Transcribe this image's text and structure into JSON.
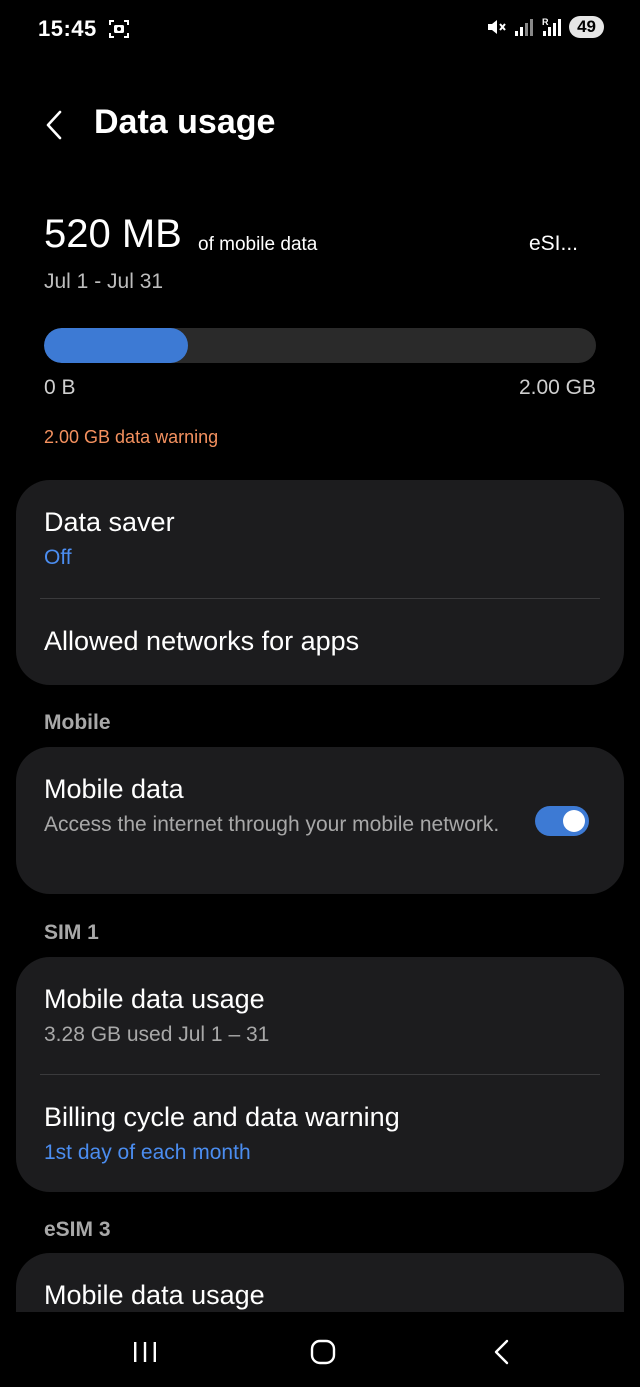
{
  "status_bar": {
    "time": "15:45",
    "battery": "49",
    "icons": [
      "screenshot-icon",
      "mute-vibrate-icon",
      "signal-icon",
      "roaming-signal-icon"
    ]
  },
  "header": {
    "back_icon": "chevron-left-icon",
    "title": "Data usage"
  },
  "usage": {
    "amount": "520 MB",
    "unit_label": "of mobile data",
    "sim": "eSI...",
    "period": "Jul 1 - Jul 31",
    "bar_min": "0 B",
    "bar_max": "2.00 GB",
    "fill_fraction": 0.26,
    "warning": "2.00 GB data warning"
  },
  "settings": {
    "data_saver_title": "Data saver",
    "data_saver_value": "Off",
    "allowed_networks": "Allowed networks for apps"
  },
  "mobile_section": {
    "label": "Mobile",
    "mobile_data_title": "Mobile data",
    "mobile_data_desc": "Access the internet through your mobile network.",
    "toggle_on": true
  },
  "sim1_section": {
    "label": "SIM 1",
    "usage_title": "Mobile data usage",
    "usage_sub": "3.28 GB used Jul 1 – 31",
    "billing_title": "Billing cycle and data warning",
    "billing_sub": "1st day of each month"
  },
  "esim3_section": {
    "label": "eSIM 3",
    "usage_title": "Mobile data usage"
  },
  "nav_bar": {
    "icons": [
      "recents-icon",
      "home-icon",
      "back-icon"
    ]
  },
  "colors": {
    "accent": "#3d7ad4",
    "link": "#4b8df0",
    "warning": "#f4915f",
    "card": "#1c1c1e"
  }
}
